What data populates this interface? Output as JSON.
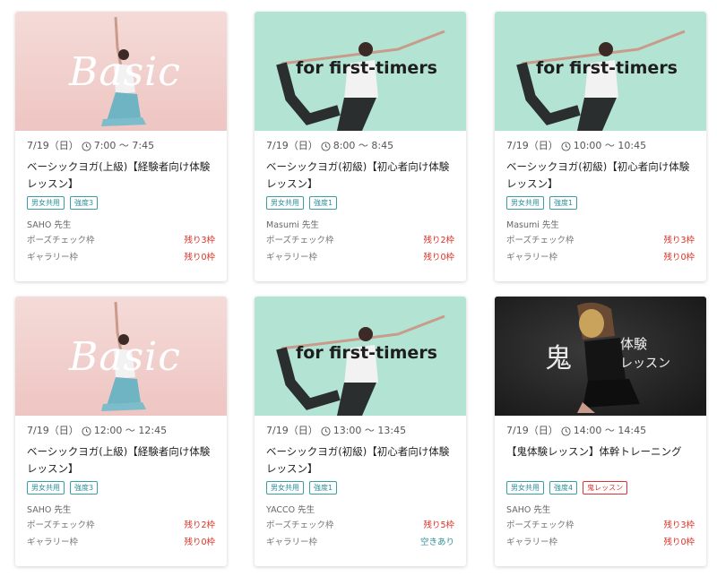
{
  "colors": {
    "basic_bg_top": "#f3d5d3",
    "basic_bg_bottom": "#efc7c4",
    "first_bg": "#b5e6d5",
    "oni_bg": "#2a2a2a",
    "accent_teal": "#2d8f98",
    "remaining_red": "#d93025"
  },
  "cards": [
    {
      "banner": "Basic",
      "date": "7/19（日）",
      "time": "7:00 〜 7:45",
      "title": "ベーシックヨガ(上級)【経験者向け体験レッスン】",
      "tags": [
        "男女共用",
        "強度3"
      ],
      "teacher": "SAHO 先生",
      "slots": [
        {
          "label": "ポーズチェック枠",
          "value": "残り3枠"
        },
        {
          "label": "ギャラリー枠",
          "value": "残り0枠"
        }
      ]
    },
    {
      "banner": "for first-timers",
      "date": "7/19（日）",
      "time": "8:00 〜 8:45",
      "title": "ベーシックヨガ(初級)【初心者向け体験レッスン】",
      "tags": [
        "男女共用",
        "強度1"
      ],
      "teacher": "Masumi 先生",
      "slots": [
        {
          "label": "ポーズチェック枠",
          "value": "残り2枠"
        },
        {
          "label": "ギャラリー枠",
          "value": "残り0枠"
        }
      ]
    },
    {
      "banner": "for first-timers",
      "date": "7/19（日）",
      "time": "10:00 〜 10:45",
      "title": "ベーシックヨガ(初級)【初心者向け体験レッスン】",
      "tags": [
        "男女共用",
        "強度1"
      ],
      "teacher": "Masumi 先生",
      "slots": [
        {
          "label": "ポーズチェック枠",
          "value": "残り3枠"
        },
        {
          "label": "ギャラリー枠",
          "value": "残り0枠"
        }
      ]
    },
    {
      "banner": "Basic",
      "date": "7/19（日）",
      "time": "12:00 〜 12:45",
      "title": "ベーシックヨガ(上級)【経験者向け体験レッスン】",
      "tags": [
        "男女共用",
        "強度3"
      ],
      "teacher": "SAHO 先生",
      "slots": [
        {
          "label": "ポーズチェック枠",
          "value": "残り2枠"
        },
        {
          "label": "ギャラリー枠",
          "value": "残り0枠"
        }
      ]
    },
    {
      "banner": "for first-timers",
      "date": "7/19（日）",
      "time": "13:00 〜 13:45",
      "title": "ベーシックヨガ(初級)【初心者向け体験レッスン】",
      "tags": [
        "男女共用",
        "強度1"
      ],
      "teacher": "YACCO 先生",
      "slots": [
        {
          "label": "ポーズチェック枠",
          "value": "残り5枠"
        },
        {
          "label": "ギャラリー枠",
          "value": "空きあり"
        }
      ]
    },
    {
      "banner_kanji": "鬼",
      "banner_line1": "体験",
      "banner_line2": "レッスン",
      "date": "7/19（日）",
      "time": "14:00 〜 14:45",
      "title": "【鬼体験レッスン】体幹トレーニング",
      "tags": [
        "男女共用",
        "強度4",
        "鬼レッスン"
      ],
      "teacher": "SAHO 先生",
      "slots": [
        {
          "label": "ポーズチェック枠",
          "value": "残り3枠"
        },
        {
          "label": "ギャラリー枠",
          "value": "残り0枠"
        }
      ]
    }
  ]
}
